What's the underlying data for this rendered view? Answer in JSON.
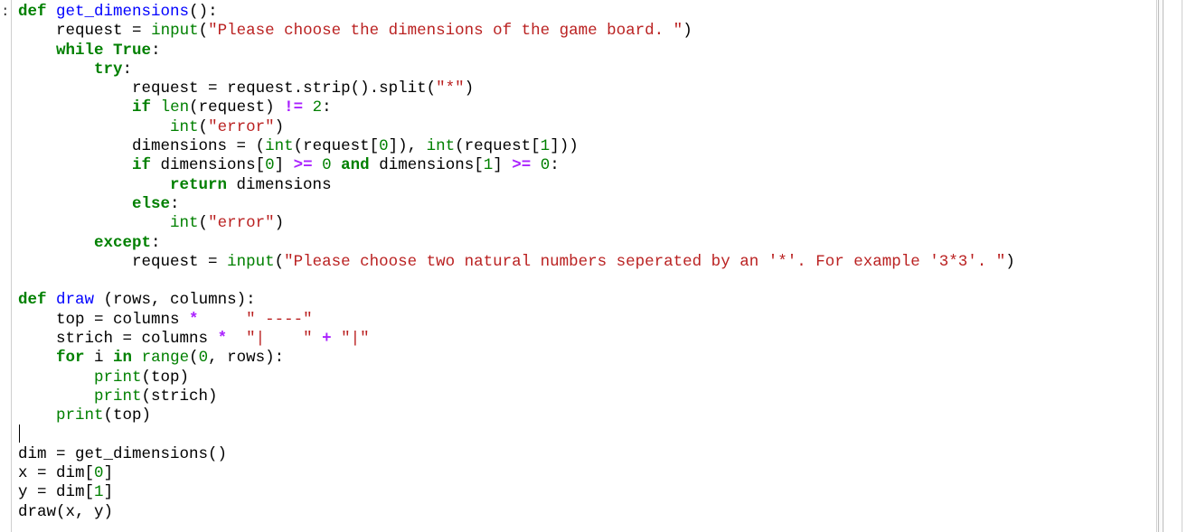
{
  "editor": {
    "prompt_marker": ":",
    "colors": {
      "keyword": "#008000",
      "builtin": "#008000",
      "string": "#ba2121",
      "number": "#008000",
      "operator": "#aa22ff",
      "function_name": "#0000ff",
      "text": "#000000"
    },
    "lines": [
      [
        {
          "t": "def",
          "c": "k"
        },
        {
          "t": " ",
          "c": "t"
        },
        {
          "t": "get_dimensions",
          "c": "fn"
        },
        {
          "t": "():",
          "c": "t"
        }
      ],
      [
        {
          "t": "    request ",
          "c": "t"
        },
        {
          "t": "=",
          "c": "t"
        },
        {
          "t": " ",
          "c": "t"
        },
        {
          "t": "input",
          "c": "b"
        },
        {
          "t": "(",
          "c": "t"
        },
        {
          "t": "\"Please choose the dimensions of the game board. \"",
          "c": "s"
        },
        {
          "t": ")",
          "c": "t"
        }
      ],
      [
        {
          "t": "    ",
          "c": "t"
        },
        {
          "t": "while",
          "c": "k"
        },
        {
          "t": " ",
          "c": "t"
        },
        {
          "t": "True",
          "c": "k"
        },
        {
          "t": ":",
          "c": "t"
        }
      ],
      [
        {
          "t": "        ",
          "c": "t"
        },
        {
          "t": "try",
          "c": "k"
        },
        {
          "t": ":",
          "c": "t"
        }
      ],
      [
        {
          "t": "            request ",
          "c": "t"
        },
        {
          "t": "=",
          "c": "t"
        },
        {
          "t": " request.strip().split(",
          "c": "t"
        },
        {
          "t": "\"*\"",
          "c": "s"
        },
        {
          "t": ")",
          "c": "t"
        }
      ],
      [
        {
          "t": "            ",
          "c": "t"
        },
        {
          "t": "if",
          "c": "k"
        },
        {
          "t": " ",
          "c": "t"
        },
        {
          "t": "len",
          "c": "b"
        },
        {
          "t": "(request) ",
          "c": "t"
        },
        {
          "t": "!=",
          "c": "o"
        },
        {
          "t": " ",
          "c": "t"
        },
        {
          "t": "2",
          "c": "n"
        },
        {
          "t": ":",
          "c": "t"
        }
      ],
      [
        {
          "t": "                ",
          "c": "t"
        },
        {
          "t": "int",
          "c": "b"
        },
        {
          "t": "(",
          "c": "t"
        },
        {
          "t": "\"error\"",
          "c": "s"
        },
        {
          "t": ")",
          "c": "t"
        }
      ],
      [
        {
          "t": "            dimensions ",
          "c": "t"
        },
        {
          "t": "=",
          "c": "t"
        },
        {
          "t": " (",
          "c": "t"
        },
        {
          "t": "int",
          "c": "b"
        },
        {
          "t": "(request[",
          "c": "t"
        },
        {
          "t": "0",
          "c": "n"
        },
        {
          "t": "]), ",
          "c": "t"
        },
        {
          "t": "int",
          "c": "b"
        },
        {
          "t": "(request[",
          "c": "t"
        },
        {
          "t": "1",
          "c": "n"
        },
        {
          "t": "]))",
          "c": "t"
        }
      ],
      [
        {
          "t": "            ",
          "c": "t"
        },
        {
          "t": "if",
          "c": "k"
        },
        {
          "t": " dimensions[",
          "c": "t"
        },
        {
          "t": "0",
          "c": "n"
        },
        {
          "t": "] ",
          "c": "t"
        },
        {
          "t": ">=",
          "c": "o"
        },
        {
          "t": " ",
          "c": "t"
        },
        {
          "t": "0",
          "c": "n"
        },
        {
          "t": " ",
          "c": "t"
        },
        {
          "t": "and",
          "c": "k"
        },
        {
          "t": " dimensions[",
          "c": "t"
        },
        {
          "t": "1",
          "c": "n"
        },
        {
          "t": "] ",
          "c": "t"
        },
        {
          "t": ">=",
          "c": "o"
        },
        {
          "t": " ",
          "c": "t"
        },
        {
          "t": "0",
          "c": "n"
        },
        {
          "t": ":",
          "c": "t"
        }
      ],
      [
        {
          "t": "                ",
          "c": "t"
        },
        {
          "t": "return",
          "c": "k"
        },
        {
          "t": " dimensions",
          "c": "t"
        }
      ],
      [
        {
          "t": "            ",
          "c": "t"
        },
        {
          "t": "else",
          "c": "k"
        },
        {
          "t": ":",
          "c": "t"
        }
      ],
      [
        {
          "t": "                ",
          "c": "t"
        },
        {
          "t": "int",
          "c": "b"
        },
        {
          "t": "(",
          "c": "t"
        },
        {
          "t": "\"error\"",
          "c": "s"
        },
        {
          "t": ")",
          "c": "t"
        }
      ],
      [
        {
          "t": "        ",
          "c": "t"
        },
        {
          "t": "except",
          "c": "k"
        },
        {
          "t": ":",
          "c": "t"
        }
      ],
      [
        {
          "t": "            request ",
          "c": "t"
        },
        {
          "t": "=",
          "c": "t"
        },
        {
          "t": " ",
          "c": "t"
        },
        {
          "t": "input",
          "c": "b"
        },
        {
          "t": "(",
          "c": "t"
        },
        {
          "t": "\"Please choose two natural numbers seperated by an '*'. For example '3*3'. \"",
          "c": "s"
        },
        {
          "t": ")",
          "c": "t"
        }
      ],
      [
        {
          "t": "",
          "c": "t"
        }
      ],
      [
        {
          "t": "def",
          "c": "k"
        },
        {
          "t": " ",
          "c": "t"
        },
        {
          "t": "draw",
          "c": "fn"
        },
        {
          "t": " (rows, columns):",
          "c": "t"
        }
      ],
      [
        {
          "t": "    top ",
          "c": "t"
        },
        {
          "t": "=",
          "c": "t"
        },
        {
          "t": " columns ",
          "c": "t"
        },
        {
          "t": "*",
          "c": "o"
        },
        {
          "t": "     ",
          "c": "t"
        },
        {
          "t": "\" ----\"",
          "c": "s"
        }
      ],
      [
        {
          "t": "    strich ",
          "c": "t"
        },
        {
          "t": "=",
          "c": "t"
        },
        {
          "t": " columns ",
          "c": "t"
        },
        {
          "t": "*",
          "c": "o"
        },
        {
          "t": "  ",
          "c": "t"
        },
        {
          "t": "\"|    \"",
          "c": "s"
        },
        {
          "t": " ",
          "c": "t"
        },
        {
          "t": "+",
          "c": "o"
        },
        {
          "t": " ",
          "c": "t"
        },
        {
          "t": "\"|\"",
          "c": "s"
        }
      ],
      [
        {
          "t": "    ",
          "c": "t"
        },
        {
          "t": "for",
          "c": "k"
        },
        {
          "t": " i ",
          "c": "t"
        },
        {
          "t": "in",
          "c": "k"
        },
        {
          "t": " ",
          "c": "t"
        },
        {
          "t": "range",
          "c": "b"
        },
        {
          "t": "(",
          "c": "t"
        },
        {
          "t": "0",
          "c": "n"
        },
        {
          "t": ", rows):",
          "c": "t"
        }
      ],
      [
        {
          "t": "        ",
          "c": "t"
        },
        {
          "t": "print",
          "c": "b"
        },
        {
          "t": "(top)",
          "c": "t"
        }
      ],
      [
        {
          "t": "        ",
          "c": "t"
        },
        {
          "t": "print",
          "c": "b"
        },
        {
          "t": "(strich)",
          "c": "t"
        }
      ],
      [
        {
          "t": "    ",
          "c": "t"
        },
        {
          "t": "print",
          "c": "b"
        },
        {
          "t": "(top)",
          "c": "t"
        }
      ],
      [
        {
          "t": "",
          "c": "t"
        }
      ],
      [
        {
          "t": "dim ",
          "c": "t"
        },
        {
          "t": "=",
          "c": "t"
        },
        {
          "t": " get_dimensions()",
          "c": "t"
        }
      ],
      [
        {
          "t": "x ",
          "c": "t"
        },
        {
          "t": "=",
          "c": "t"
        },
        {
          "t": " dim[",
          "c": "t"
        },
        {
          "t": "0",
          "c": "n"
        },
        {
          "t": "]",
          "c": "t"
        }
      ],
      [
        {
          "t": "y ",
          "c": "t"
        },
        {
          "t": "=",
          "c": "t"
        },
        {
          "t": " dim[",
          "c": "t"
        },
        {
          "t": "1",
          "c": "n"
        },
        {
          "t": "]",
          "c": "t"
        }
      ],
      [
        {
          "t": "draw(x, y)",
          "c": "t"
        }
      ]
    ]
  }
}
